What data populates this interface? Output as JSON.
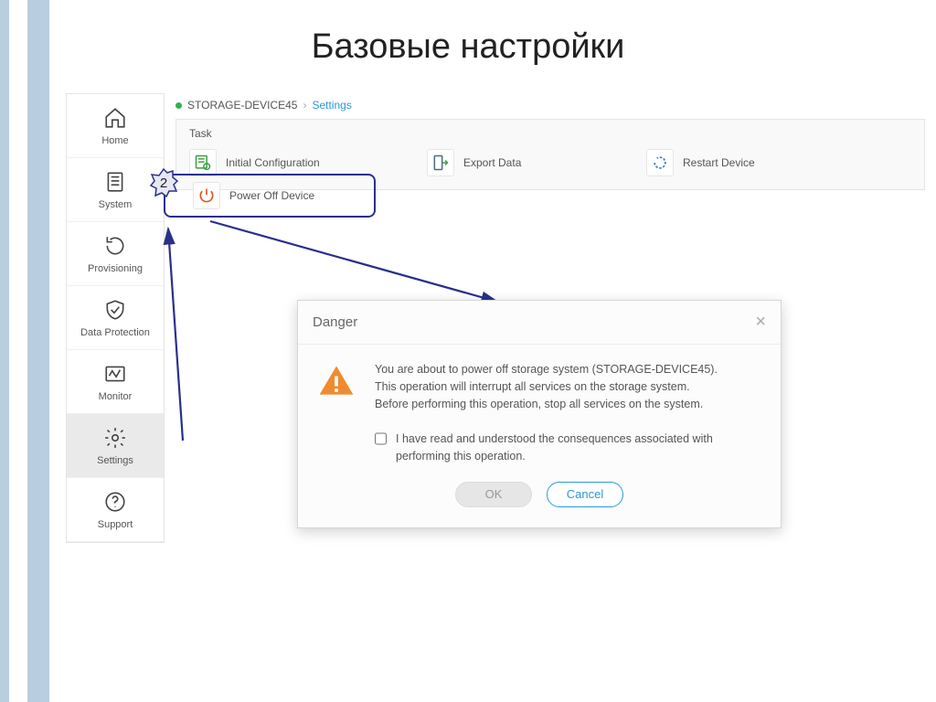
{
  "slide": {
    "title": "Базовые настройки"
  },
  "sidebar": {
    "items": [
      {
        "label": "Home"
      },
      {
        "label": "System"
      },
      {
        "label": "Provisioning"
      },
      {
        "label": "Data Protection"
      },
      {
        "label": "Monitor"
      },
      {
        "label": "Settings"
      },
      {
        "label": "Support"
      }
    ]
  },
  "breadcrumb": {
    "device": "STORAGE-DEVICE45",
    "page": "Settings",
    "separator": "›"
  },
  "panel": {
    "title": "Task",
    "tasks": [
      {
        "label": "Initial Configuration"
      },
      {
        "label": "Export Data"
      },
      {
        "label": "Restart Device"
      }
    ],
    "poweroff_label": "Power Off Device"
  },
  "badge": {
    "number": "2"
  },
  "dialog": {
    "title": "Danger",
    "close": "×",
    "line1": "You are about to power off storage system (STORAGE-DEVICE45).",
    "line2": "This operation will interrupt all services on the storage system.",
    "line3": "Before performing this operation, stop all services on the system.",
    "consent": "I have read and understood the consequences associated with performing this operation.",
    "ok": "OK",
    "cancel": "Cancel"
  }
}
